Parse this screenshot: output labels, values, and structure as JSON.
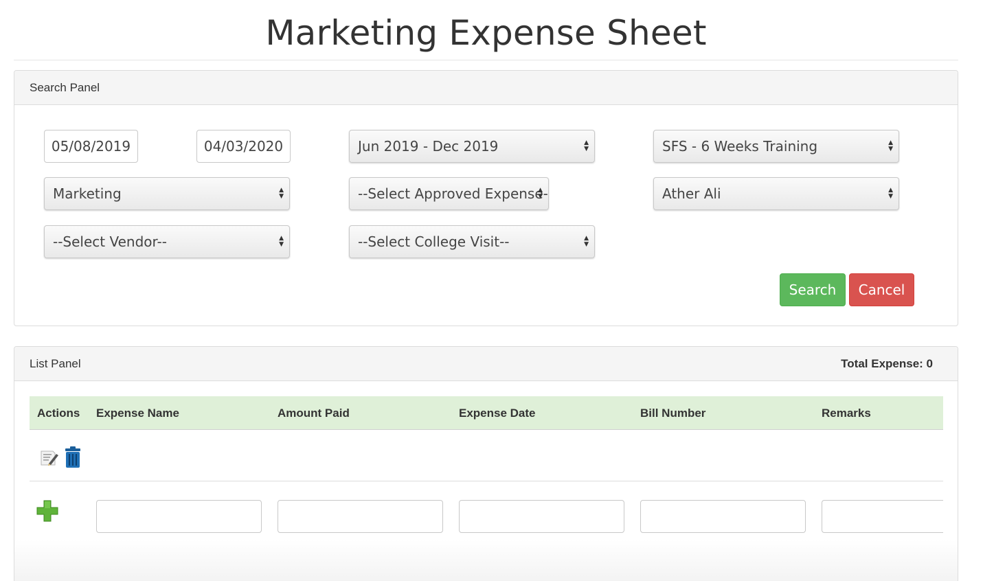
{
  "page": {
    "title": "Marketing Expense Sheet"
  },
  "search_panel": {
    "heading": "Search Panel",
    "from_date": "05/08/2019",
    "to_date": "04/03/2020",
    "period_select": "Jun 2019 - Dec 2019",
    "training_select": "SFS - 6 Weeks Training",
    "department_select": "Marketing",
    "approved_expense_select": "--Select Approved Expense--",
    "employee_select": "Ather Ali",
    "vendor_select": "--Select Vendor--",
    "college_visit_select": "--Select College Visit--",
    "search_label": "Search",
    "cancel_label": "Cancel"
  },
  "list_panel": {
    "heading": "List Panel",
    "total_expense": "Total Expense: 0",
    "columns": [
      "Actions",
      "Expense Name",
      "Amount Paid",
      "Expense Date",
      "Bill Number",
      "Remarks"
    ],
    "row_icons": [
      "edit-icon",
      "delete-icon"
    ],
    "add_icon": "add-plus-icon"
  },
  "colors": {
    "search_button": "#5cb85c",
    "cancel_button": "#d9534f",
    "table_header": "#dff0d8",
    "add_icon": "#5fb33a",
    "delete_icon": "#1f6fb5"
  }
}
